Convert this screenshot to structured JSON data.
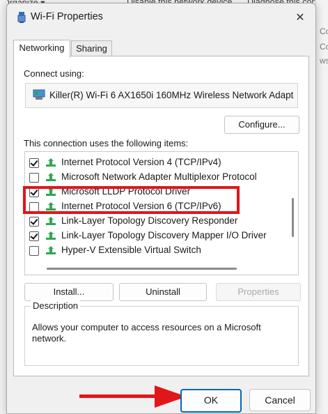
{
  "background": {
    "organize_text": "Organize ▾",
    "disable_text": "Disable this network device",
    "diagnose_text": "Diagnose this conn",
    "right_text": [
      "Co",
      "Co",
      "ws"
    ]
  },
  "dialog": {
    "title": "Wi-Fi Properties",
    "close_glyph": "✕",
    "tabs": [
      {
        "label": "Networking",
        "active": true
      },
      {
        "label": "Sharing",
        "active": false
      }
    ],
    "connect_using_label": "Connect using:",
    "adapter_name": "Killer(R) Wi-Fi 6 AX1650i 160MHz Wireless Network Adapt",
    "configure_button": "Configure...",
    "items_label": "This connection uses the following items:",
    "items": [
      {
        "label": "Internet Protocol Version 4 (TCP/IPv4)",
        "checked": true
      },
      {
        "label": "Microsoft Network Adapter Multiplexor Protocol",
        "checked": false
      },
      {
        "label": "Microsoft LLDP Protocol Driver",
        "checked": true
      },
      {
        "label": "Internet Protocol Version 6 (TCP/IPv6)",
        "checked": false
      },
      {
        "label": "Link-Layer Topology Discovery Responder",
        "checked": true
      },
      {
        "label": "Link-Layer Topology Discovery Mapper I/O Driver",
        "checked": true
      },
      {
        "label": "Hyper-V Extensible Virtual Switch",
        "checked": false
      }
    ],
    "install_button": "Install...",
    "uninstall_button": "Uninstall",
    "properties_button": "Properties",
    "description_title": "Description",
    "description_text": "Allows your computer to access resources on a Microsoft network.",
    "ok_button": "OK",
    "cancel_button": "Cancel"
  },
  "colors": {
    "highlight": "#e0161b",
    "arrow": "#e0161b",
    "ok_border": "#0067c0",
    "protocol_icon": "#2fa84f"
  },
  "icons": {
    "title": "wifi-adapter-icon",
    "adapter": "network-card-icon",
    "protocol": "network-protocol-icon",
    "close": "close-icon",
    "arrow": "arrow-right-icon"
  }
}
